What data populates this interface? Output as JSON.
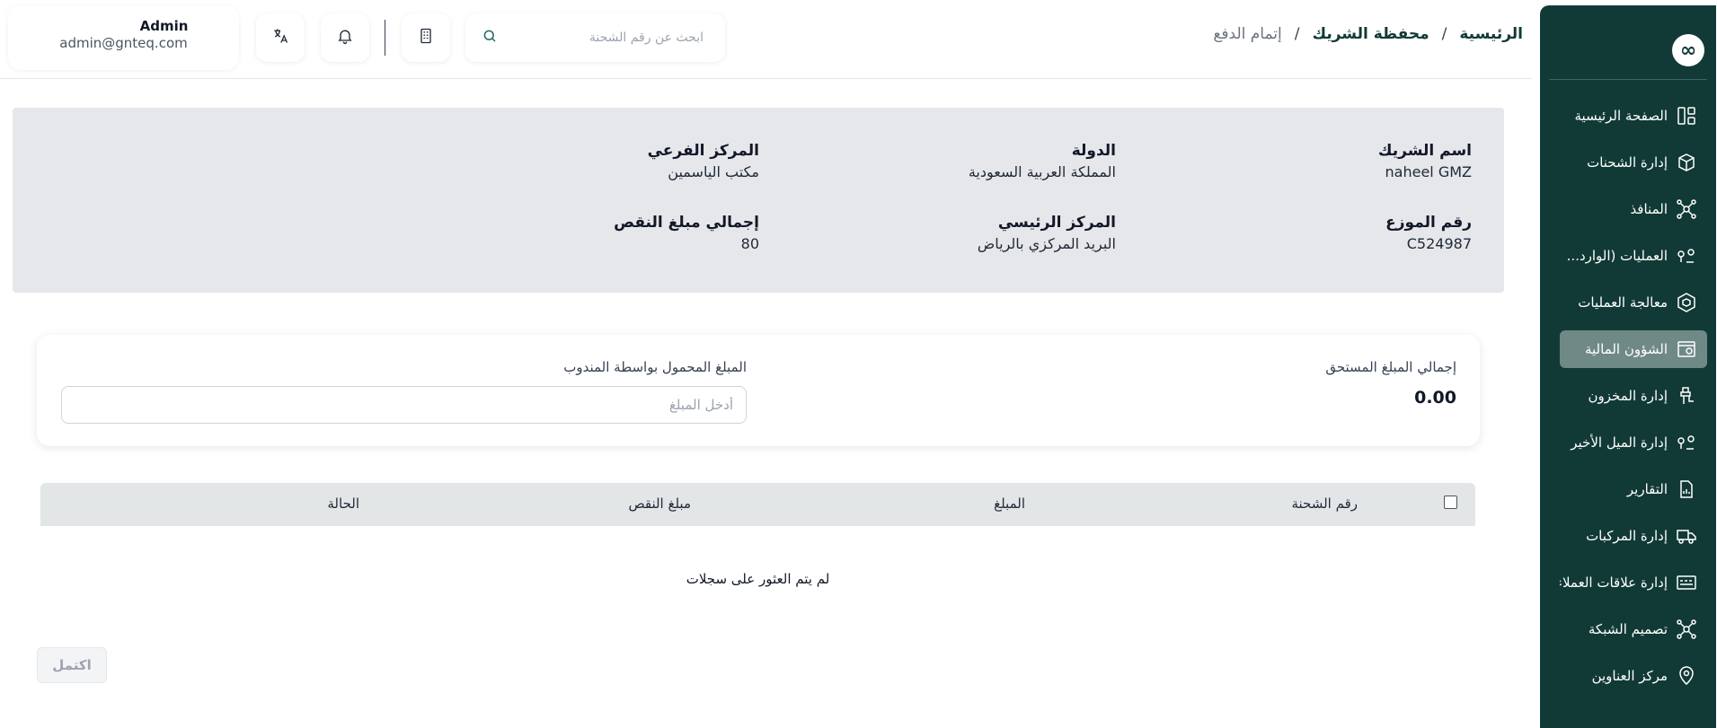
{
  "user": {
    "name": "Admin",
    "email": "admin@gnteq.com"
  },
  "search": {
    "placeholder": "ابحث عن رقم الشحنة"
  },
  "breadcrumb": {
    "home": "الرئيسية",
    "wallet": "محفظة الشريك",
    "current": "إتمام الدفع",
    "separator": "/"
  },
  "partner": {
    "name_label": "اسم الشريك",
    "name_value": "naheel GMZ",
    "country_label": "الدولة",
    "country_value": "المملكة العربية السعودية",
    "branch_label": "المركز الفرعي",
    "branch_value": "مكتب الياسمين",
    "distributor_label": "رقم الموزع",
    "distributor_value": "C524987",
    "main_center_label": "المركز الرئيسي",
    "main_center_value": "البريد المركزي بالرياض",
    "shortage_label": "إجمالي مبلغ النقص",
    "shortage_value": "80"
  },
  "amounts": {
    "total_due_label": "إجمالي المبلغ المستحق",
    "total_due_value": "0.00",
    "carried_label": "المبلغ المحمول بواسطة المندوب",
    "carried_placeholder": "أدخل المبلغ"
  },
  "table": {
    "columns": [
      "رقم الشحنة",
      "المبلغ",
      "مبلغ النقص",
      "الحالة"
    ],
    "empty_message": "لم يتم العثور على سجلات"
  },
  "actions": {
    "complete_label": "اكتمل"
  },
  "sidebar": {
    "logo": "∞",
    "items": [
      {
        "label": "الصفحة الرئيسية",
        "icon": "dashboard-icon"
      },
      {
        "label": "إدارة الشحنات",
        "icon": "box-icon"
      },
      {
        "label": "المنافذ",
        "icon": "network-icon"
      },
      {
        "label": "العمليات (الوارد...",
        "icon": "route-icon"
      },
      {
        "label": "معالجة العمليات",
        "icon": "package-icon"
      },
      {
        "label": "الشؤون المالية",
        "icon": "finance-icon",
        "active": true
      },
      {
        "label": "إدارة المخزون",
        "icon": "inventory-icon"
      },
      {
        "label": "إدارة الميل الأخير",
        "icon": "last-mile-icon"
      },
      {
        "label": "التقارير",
        "icon": "report-icon"
      },
      {
        "label": "إدارة المركبات",
        "icon": "truck-icon"
      },
      {
        "label": "إدارة علاقات العملاء",
        "icon": "crm-icon"
      },
      {
        "label": "تصميم الشبكة",
        "icon": "network-design-icon"
      },
      {
        "label": "مركز العناوين",
        "icon": "location-icon"
      }
    ]
  },
  "colors": {
    "sidebar_bg": "#113a36",
    "active_item_bg": "#6f8986",
    "panel_bg": "#e5e7ea",
    "brand": "#113a36"
  }
}
